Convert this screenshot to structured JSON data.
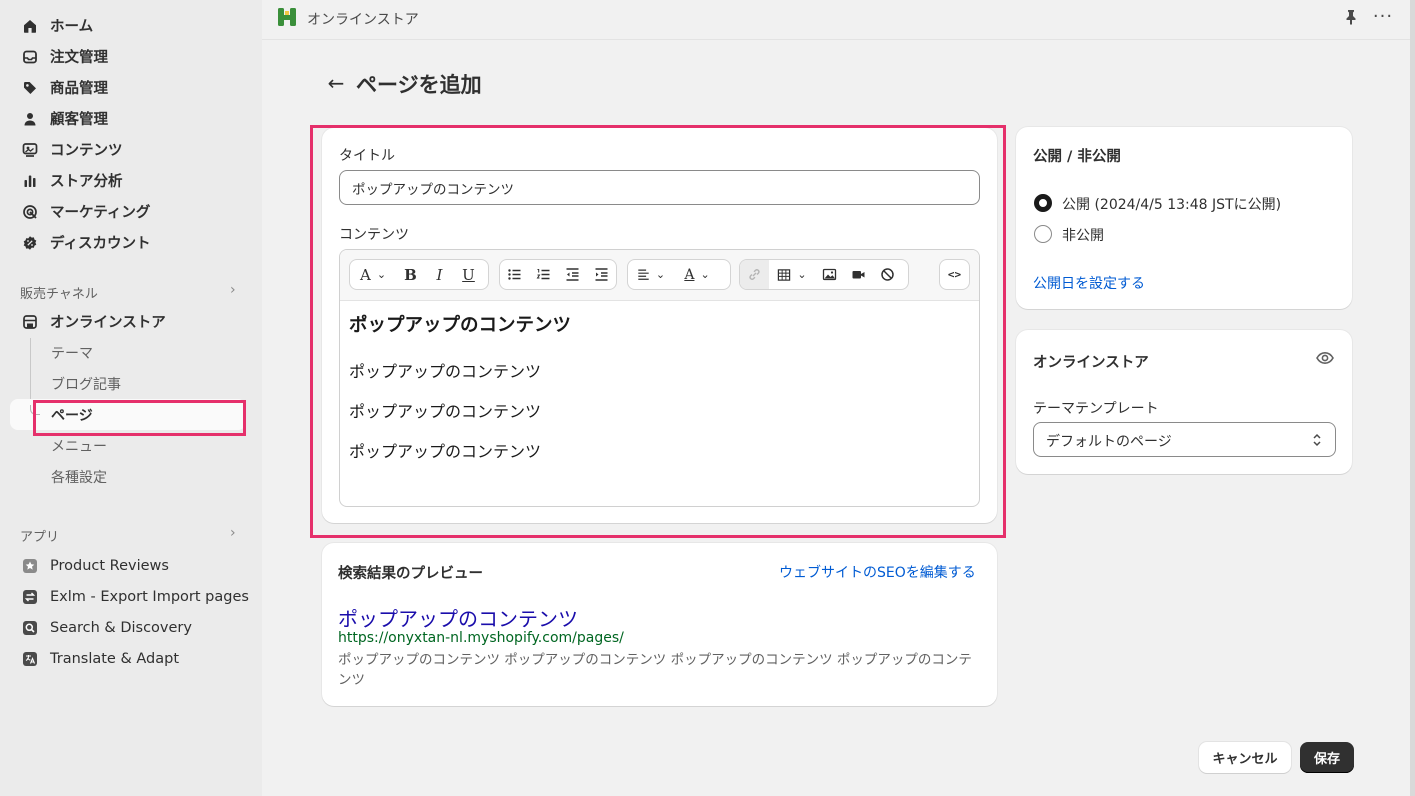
{
  "sidebar": {
    "main_items": [
      {
        "label": "ホーム",
        "icon": "home-icon"
      },
      {
        "label": "注文管理",
        "icon": "inbox-icon"
      },
      {
        "label": "商品管理",
        "icon": "tag-icon"
      },
      {
        "label": "顧客管理",
        "icon": "person-icon"
      },
      {
        "label": "コンテンツ",
        "icon": "content-icon"
      },
      {
        "label": "ストア分析",
        "icon": "bar-chart-icon"
      },
      {
        "label": "マーケティング",
        "icon": "target-icon"
      },
      {
        "label": "ディスカウント",
        "icon": "discount-icon"
      }
    ],
    "sales_channels_label": "販売チャネル",
    "online_store": {
      "label": "オンラインストア",
      "icon": "store-icon"
    },
    "online_store_sub": [
      {
        "label": "テーマ"
      },
      {
        "label": "ブログ記事"
      },
      {
        "label": "ページ"
      },
      {
        "label": "メニュー"
      },
      {
        "label": "各種設定"
      }
    ],
    "apps_label": "アプリ",
    "apps": [
      {
        "label": "Product Reviews",
        "icon": "star-icon"
      },
      {
        "label": "Exlm - Export Import pages",
        "icon": "export-import-icon"
      },
      {
        "label": "Search & Discovery",
        "icon": "search-discovery-icon"
      },
      {
        "label": "Translate & Adapt",
        "icon": "translate-icon"
      }
    ]
  },
  "topbar": {
    "store_name": "オンラインストア",
    "more": "···"
  },
  "page": {
    "back": "←",
    "title": "ページを追加"
  },
  "form": {
    "title_label": "タイトル",
    "title_value": "ポップアップのコンテンツ",
    "content_label": "コンテンツ",
    "toolbar": {
      "font": "A",
      "bold": "B",
      "italic": "I",
      "underline": "U",
      "color": "A",
      "html": "<>"
    },
    "content": {
      "heading": "ポップアップのコンテンツ",
      "paragraphs": [
        "ポップアップのコンテンツ",
        "ポップアップのコンテンツ",
        "ポップアップのコンテンツ"
      ]
    }
  },
  "seo": {
    "title": "検索結果のプレビュー",
    "edit_link": "ウェブサイトのSEOを編集する",
    "page_title": "ポップアップのコンテンツ",
    "url": "https://onyxtan-nl.myshopify.com/pages/",
    "description": "ポップアップのコンテンツ ポップアップのコンテンツ ポップアップのコンテンツ ポップアップのコンテンツ"
  },
  "visibility": {
    "title": "公開 / 非公開",
    "options": [
      {
        "label": "公開 (2024/4/5 13:48 JSTに公開)",
        "checked": true
      },
      {
        "label": "非公開",
        "checked": false
      }
    ],
    "set_date_link": "公開日を設定する"
  },
  "online_store_card": {
    "title": "オンラインストア",
    "template_label": "テーマテンプレート",
    "template_value": "デフォルトのページ"
  },
  "footer": {
    "cancel": "キャンセル",
    "save": "保存"
  },
  "colors": {
    "highlight": "#e5306b",
    "link": "#005bd3",
    "seo_title": "#1a0dab",
    "seo_url": "#006621"
  }
}
